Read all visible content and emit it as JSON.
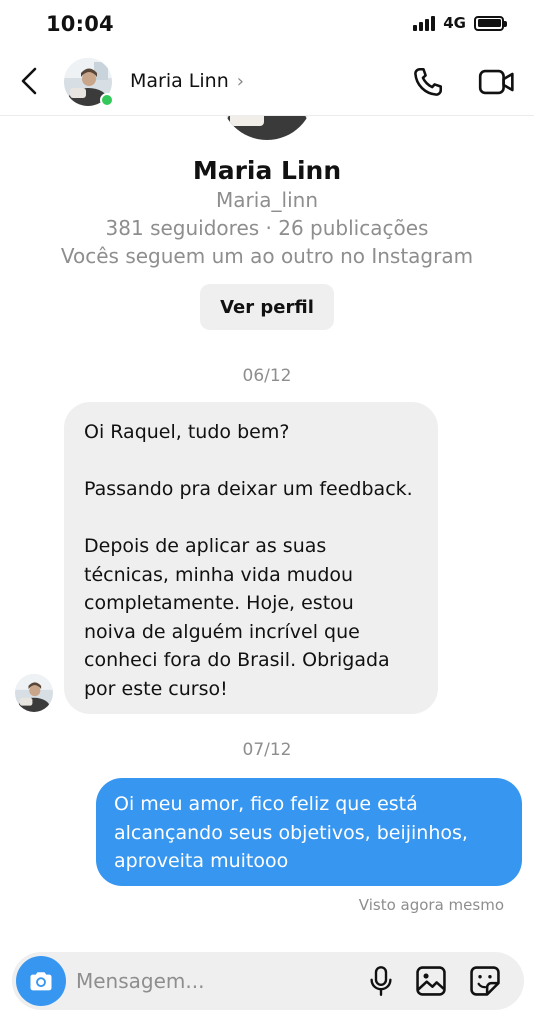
{
  "status_bar": {
    "time": "10:04",
    "network": "4G"
  },
  "header": {
    "contact_name": "Maria Linn",
    "chevron": "›"
  },
  "profile": {
    "name": "Maria Linn",
    "username": "Maria_linn",
    "stats": "381 seguidores · 26 publicações",
    "mutual": "Vocês seguem um ao outro no Instagram",
    "view_profile_label": "Ver perfil"
  },
  "messages": [
    {
      "date": "06/12",
      "direction": "incoming",
      "lines": [
        "Oi Raquel, tudo bem?",
        "",
        "Passando pra deixar um feedback.",
        "",
        "Depois de aplicar as suas",
        "técnicas, minha vida mudou",
        "completamente. Hoje, estou",
        "noiva de alguém incrível que",
        "conheci fora do Brasil. Obrigada",
        "por este curso!"
      ]
    },
    {
      "date": "07/12",
      "direction": "outgoing",
      "lines": [
        "Oi meu amor, fico feliz que está",
        "alcançando seus objetivos, beijinhos,",
        "aproveita muitooo"
      ],
      "status": "Visto agora mesmo"
    }
  ],
  "composer": {
    "placeholder": "Mensagem..."
  },
  "icons": {
    "back": "back-arrow-icon",
    "call": "phone-icon",
    "video": "video-camera-icon",
    "camera": "camera-icon",
    "mic": "microphone-icon",
    "gallery": "gallery-icon",
    "sticker": "sticker-icon"
  },
  "colors": {
    "accent": "#3797f0",
    "incoming_bubble": "#efefef",
    "online": "#34c759",
    "muted_text": "#8e8e8e"
  }
}
